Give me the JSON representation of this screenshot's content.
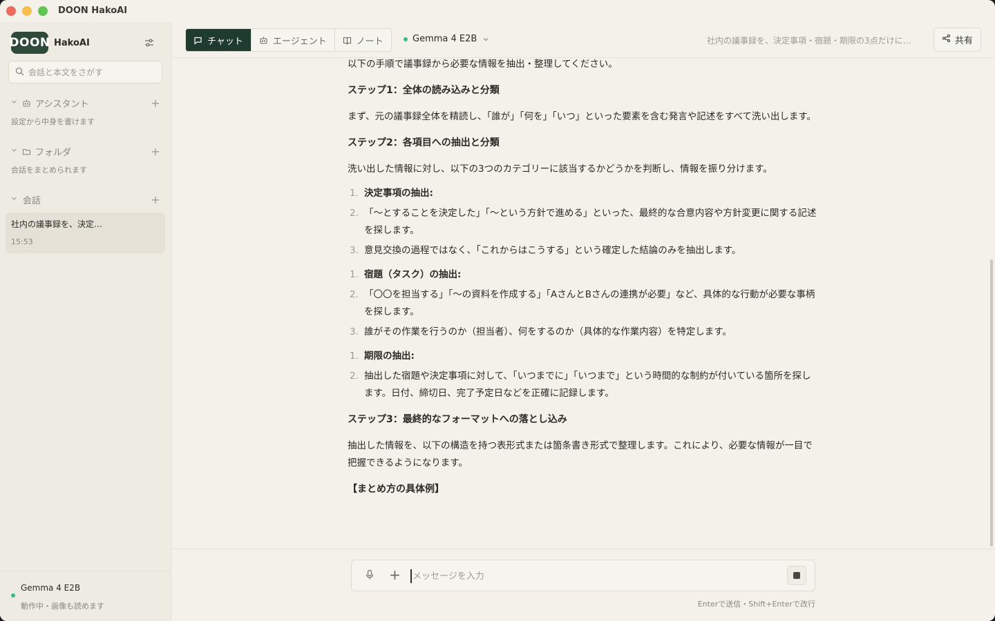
{
  "app": {
    "title": "DOON HakoAI"
  },
  "sidebar": {
    "logo_text": "DOON",
    "brand": "HakoAI",
    "search_placeholder": "会話と本文をさがす",
    "sections": [
      {
        "title": "アシスタント",
        "sub": "設定から中身を書けます"
      },
      {
        "title": "フォルダ",
        "sub": "会話をまとめられます"
      },
      {
        "title": "会話",
        "sub": ""
      }
    ],
    "conversations": [
      {
        "title": "社内の議事録を、決定…",
        "time": "15:53"
      }
    ],
    "status": {
      "model": "Gemma 4 E2B",
      "sub": "動作中・画像も読めます",
      "color": "#3fb97f"
    }
  },
  "toolbar": {
    "tabs": [
      {
        "label": "チャット",
        "active": true
      },
      {
        "label": "エージェント",
        "active": false
      },
      {
        "label": "ノート",
        "active": false
      }
    ],
    "model": "Gemma 4 E2B",
    "conversation_title": "社内の議事録を、決定事項・宿題・期限の3点だけに…",
    "share_label": "共有"
  },
  "message": {
    "intro": "以下の手順で議事録から必要な情報を抽出・整理してください。",
    "step1": {
      "heading": "ステップ1：全体の読み込みと分類",
      "body": "まず、元の議事録全体を精読し、「誰が」「何を」「いつ」といった要素を含む発言や記述をすべて洗い出します。"
    },
    "step2": {
      "heading": "ステップ2：各項目への抽出と分類",
      "body": "洗い出した情報に対し、以下の3つのカテゴリーに該当するかどうかを判断し、情報を振り分けます。",
      "list_a": [
        {
          "num": "1.",
          "text": "決定事項の抽出:",
          "bold": true
        },
        {
          "num": "2.",
          "text": "「〜とすることを決定した」「〜という方針で進める」といった、最終的な合意内容や方針変更に関する記述を探します。"
        },
        {
          "num": "3.",
          "text": "意見交換の過程ではなく、「これからはこうする」という確定した結論のみを抽出します。"
        }
      ],
      "list_b": [
        {
          "num": "1.",
          "text": "宿題（タスク）の抽出:",
          "bold": true
        },
        {
          "num": "2.",
          "text": "「〇〇を担当する」「〜の資料を作成する」「AさんとBさんの連携が必要」など、具体的な行動が必要な事柄を探します。"
        },
        {
          "num": "3.",
          "text": "誰がその作業を行うのか（担当者）、何をするのか（具体的な作業内容）を特定します。"
        }
      ],
      "list_c": [
        {
          "num": "1.",
          "text": "期限の抽出:",
          "bold": true
        },
        {
          "num": "2.",
          "text": "抽出した宿題や決定事項に対して、「いつまでに」「いつまで」という時間的な制約が付いている箇所を探します。日付、締切日、完了予定日などを正確に記録します。"
        }
      ]
    },
    "step3": {
      "heading": "ステップ3：最終的なフォーマットへの落とし込み",
      "body": "抽出した情報を、以下の構造を持つ表形式または箇条書き形式で整理します。これにより、必要な情報が一目で把握できるようになります。",
      "example_heading": "【まとめ方の具体例】"
    }
  },
  "composer": {
    "placeholder": "メッセージを入力",
    "hint": "Enterで送信・Shift+Enterで改行"
  }
}
